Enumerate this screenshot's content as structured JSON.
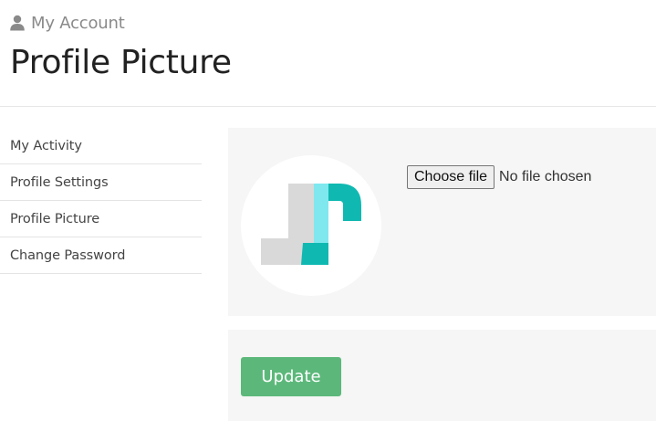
{
  "header": {
    "account_icon": "user-icon",
    "account_label": "My Account",
    "page_title": "Profile Picture"
  },
  "sidebar": {
    "items": [
      {
        "label": "My Activity"
      },
      {
        "label": "Profile Settings"
      },
      {
        "label": "Profile Picture"
      },
      {
        "label": "Change Password"
      }
    ]
  },
  "upload": {
    "avatar_logo": "JR monogram logo",
    "choose_file_label": "Choose file",
    "file_status": "No file chosen"
  },
  "actions": {
    "update_label": "Update"
  },
  "colors": {
    "update_button": "#5cb87a",
    "panel_background": "#f5f6f5",
    "logo_teal": "#0fb9b1",
    "logo_cyan": "#7ee8ee",
    "logo_gray": "#d9d9d9"
  }
}
